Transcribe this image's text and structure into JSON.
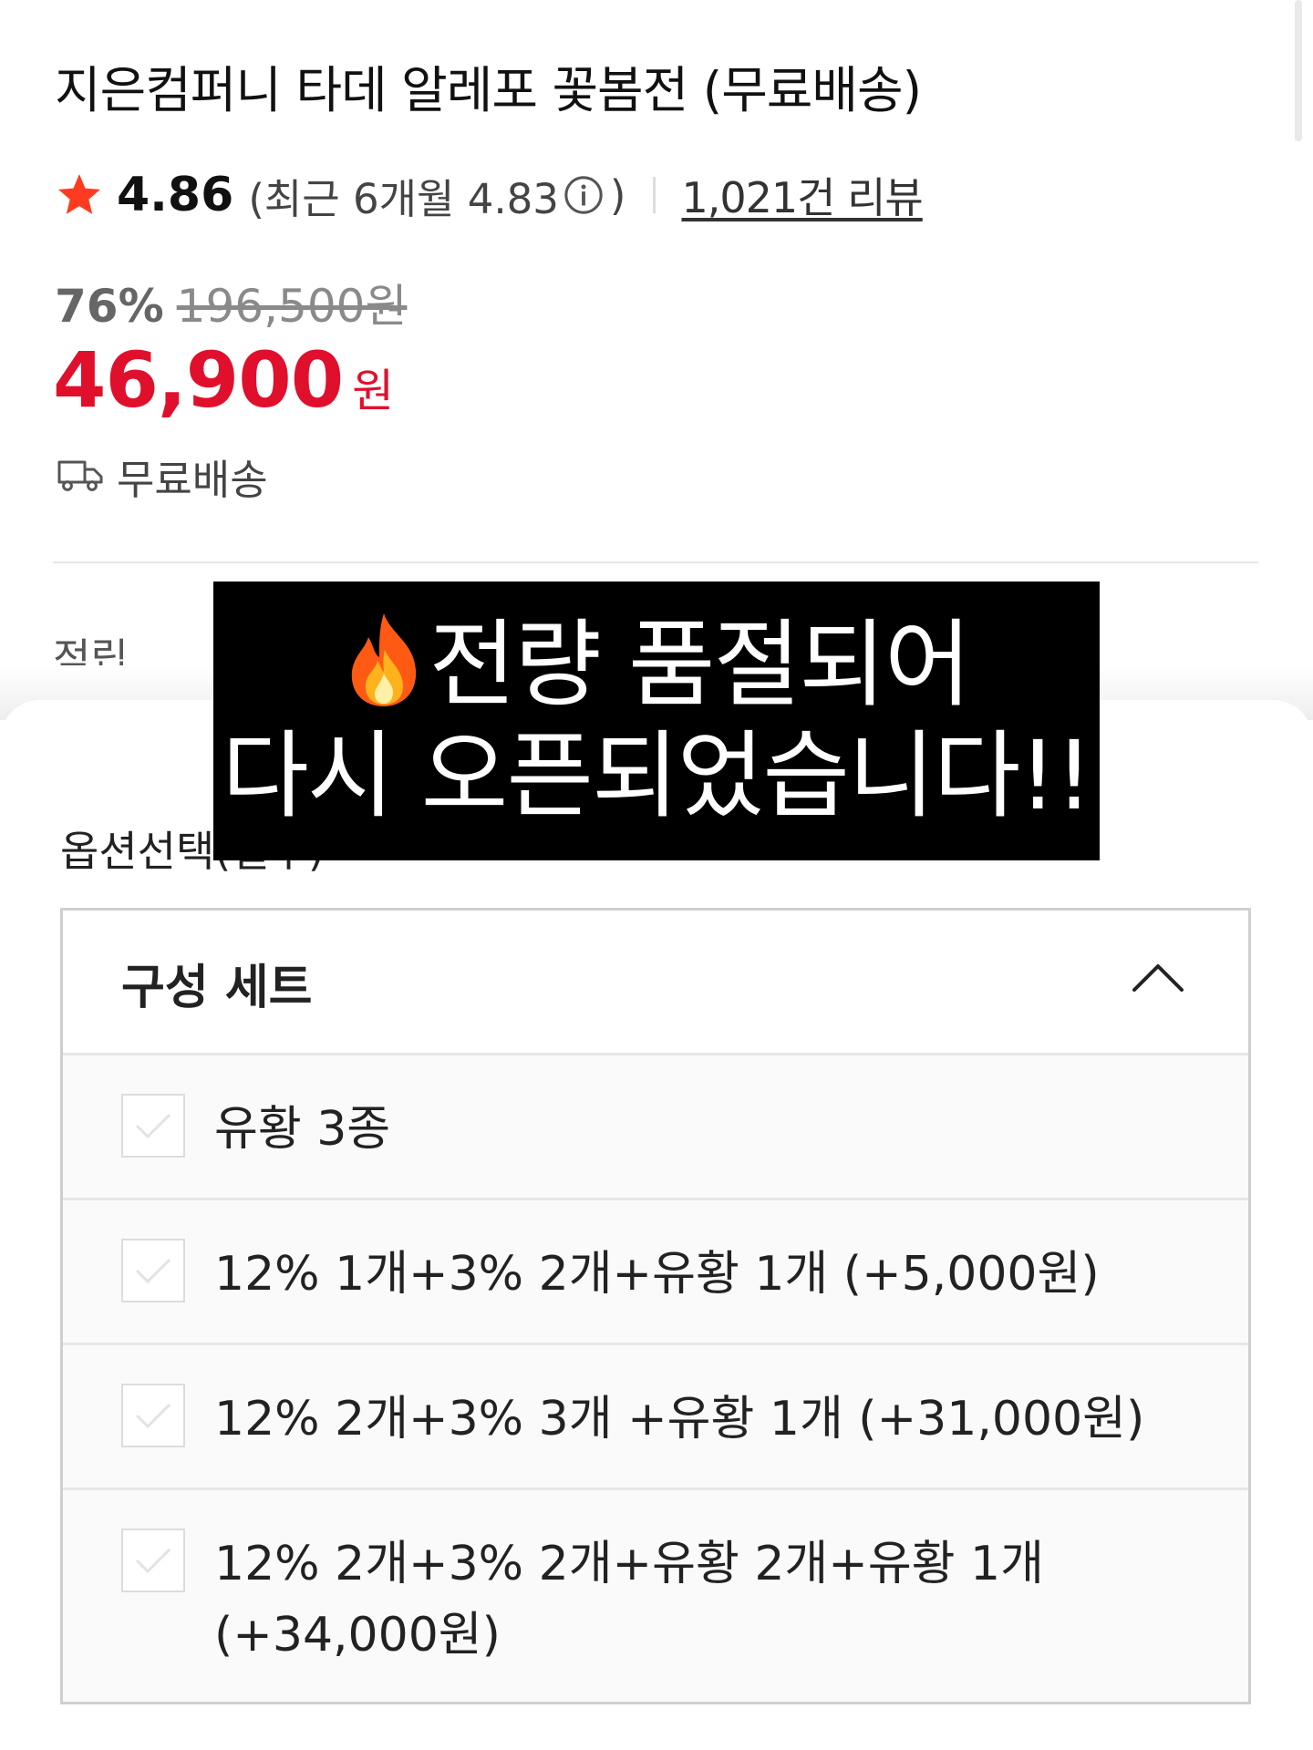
{
  "product": {
    "title": "지은컴퍼니 타데 알레포 꽃봄전 (무료배송)",
    "rating": "4.86",
    "recent_rating_text": "(최근 6개월 4.83",
    "recent_rating_close": ")",
    "review_count": "1,021건 리뷰",
    "discount_rate": "76%",
    "original_price": "196,500원",
    "sale_price": "46,900",
    "price_unit": "원",
    "shipping": "무료배송",
    "points_label": "적립"
  },
  "options": {
    "heading": "옵션선택(필수)",
    "group_title": "구성 세트",
    "items": [
      {
        "label": "유황 3종"
      },
      {
        "label": "12% 1개+3% 2개+유황 1개 (+5,000원)"
      },
      {
        "label": "12% 2개+3% 3개 +유황 1개 (+31,000원)"
      },
      {
        "label": "12% 2개+3% 2개+유황 2개+유황 1개 (+34,000원)"
      }
    ]
  },
  "banner": {
    "line1": "전량 품절되어",
    "line2": "다시 오픈되었습니다!!"
  },
  "icons": {
    "star": "star-icon",
    "info": "info-icon",
    "truck": "truck-icon",
    "chevron": "chevron-up-icon",
    "check": "check-icon",
    "fire": "fire-icon"
  },
  "colors": {
    "price_red": "#e0102c",
    "star_red": "#ff3b1f",
    "banner_bg": "#000000"
  }
}
